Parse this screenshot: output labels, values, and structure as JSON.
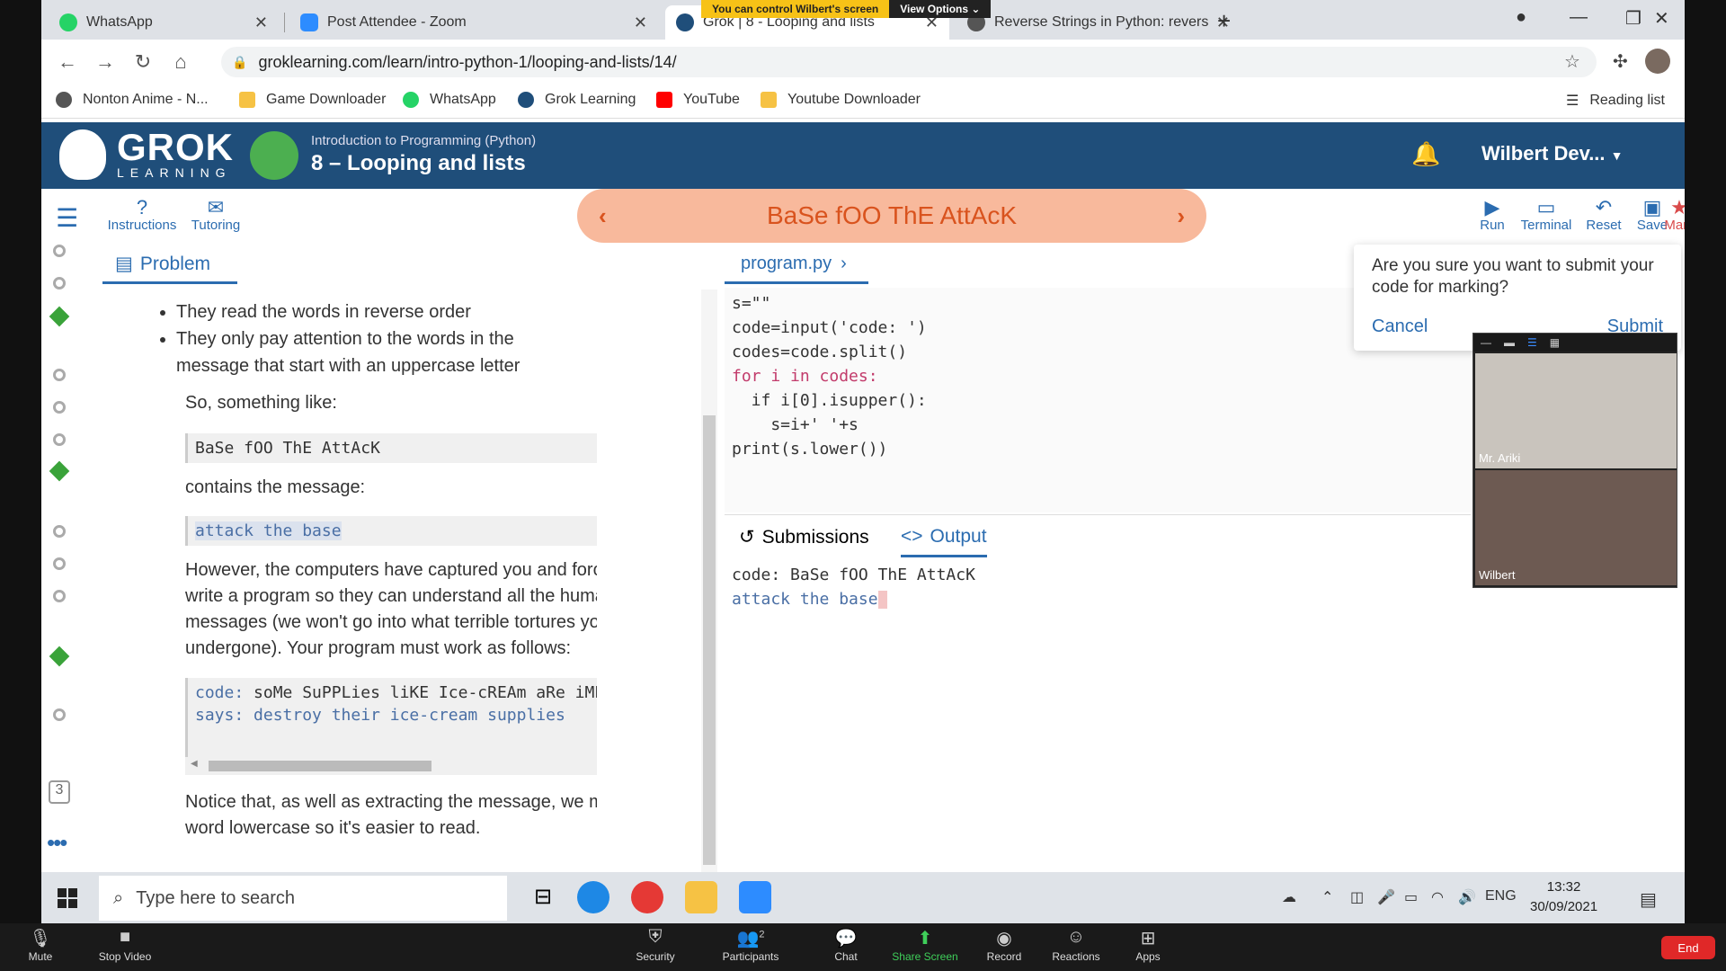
{
  "browser": {
    "tabs": [
      {
        "title": "WhatsApp",
        "color": "#25d366"
      },
      {
        "title": "Post Attendee - Zoom",
        "color": "#2d8cff"
      },
      {
        "title": "Grok | 8 - Looping and lists",
        "color": "#1f4e7a"
      },
      {
        "title": "Reverse Strings in Python: revers",
        "color": "#555555"
      }
    ],
    "url": "groklearning.com/learn/intro-python-1/looping-and-lists/14/",
    "bookmarks": [
      "Nonton Anime - N...",
      "Game Downloader",
      "WhatsApp",
      "Grok Learning",
      "YouTube",
      "Youtube Downloader"
    ],
    "reading_list": "Reading list"
  },
  "zoom_banner": {
    "control": "You can control Wilbert's screen",
    "options": "View Options"
  },
  "grok": {
    "brand": "GROK",
    "brand_sub": "LEARNING",
    "course": "Introduction to Programming (Python)",
    "module": "8 – Looping and lists",
    "user": "Wilbert Dev..."
  },
  "toolbar": {
    "instructions": "Instructions",
    "tutoring": "Tutoring",
    "problem_title": "BaSe fOO ThE AttAcK",
    "run": "Run",
    "terminal": "Terminal",
    "reset": "Reset",
    "save": "Save",
    "mark": "Mark"
  },
  "problem": {
    "tab": "Problem",
    "bullets": [
      "They read the words in reverse order",
      "They only pay attention to the words in the message that start with an uppercase letter"
    ],
    "p1": "So, something like:",
    "code1": "BaSe fOO ThE AttAcK",
    "p2": "contains the message:",
    "code2": "attack the base",
    "p3": "However, the computers have captured you and forced you to write a program so they can understand all the human messages (we won't go into what terrible tortures you've undergone). Your program must work as follows:",
    "code3_line1_label": "code:",
    "code3_line1_value": "soMe SuPPLies liKE Ice-cREAm aRe iMPORtant",
    "code3_line2": "says: destroy their ice-cream supplies",
    "p4": "Notice that, as well as extracting the message, we make every word lowercase so it's easier to read.",
    "rail_number": "3"
  },
  "editor": {
    "filename": "program.py",
    "lines": [
      "s=\"\"",
      "code=input('code: ')",
      "codes=code.split()",
      "for i in codes:",
      "  if i[0].isupper():",
      "    s=i+' '+s",
      "print(s.lower())"
    ]
  },
  "output": {
    "tab_submissions": "Submissions",
    "tab_output": "Output",
    "line1": "code: BaSe fOO ThE AttAcK",
    "line2": "attack the base"
  },
  "confirm": {
    "question": "Are you sure you want to submit your code for marking?",
    "cancel": "Cancel",
    "submit": "Submit"
  },
  "gallery": {
    "participants": [
      "Mr. Ariki",
      "Wilbert"
    ]
  },
  "taskbar": {
    "search_placeholder": "Type here to search",
    "lang": "ENG",
    "time": "13:32",
    "date": "30/09/2021"
  },
  "zoombar": {
    "mute": "Mute",
    "stop_video": "Stop Video",
    "security": "Security",
    "participants": "Participants",
    "participant_count": "2",
    "chat": "Chat",
    "share_screen": "Share Screen",
    "record": "Record",
    "reactions": "Reactions",
    "apps": "Apps",
    "end": "End"
  }
}
